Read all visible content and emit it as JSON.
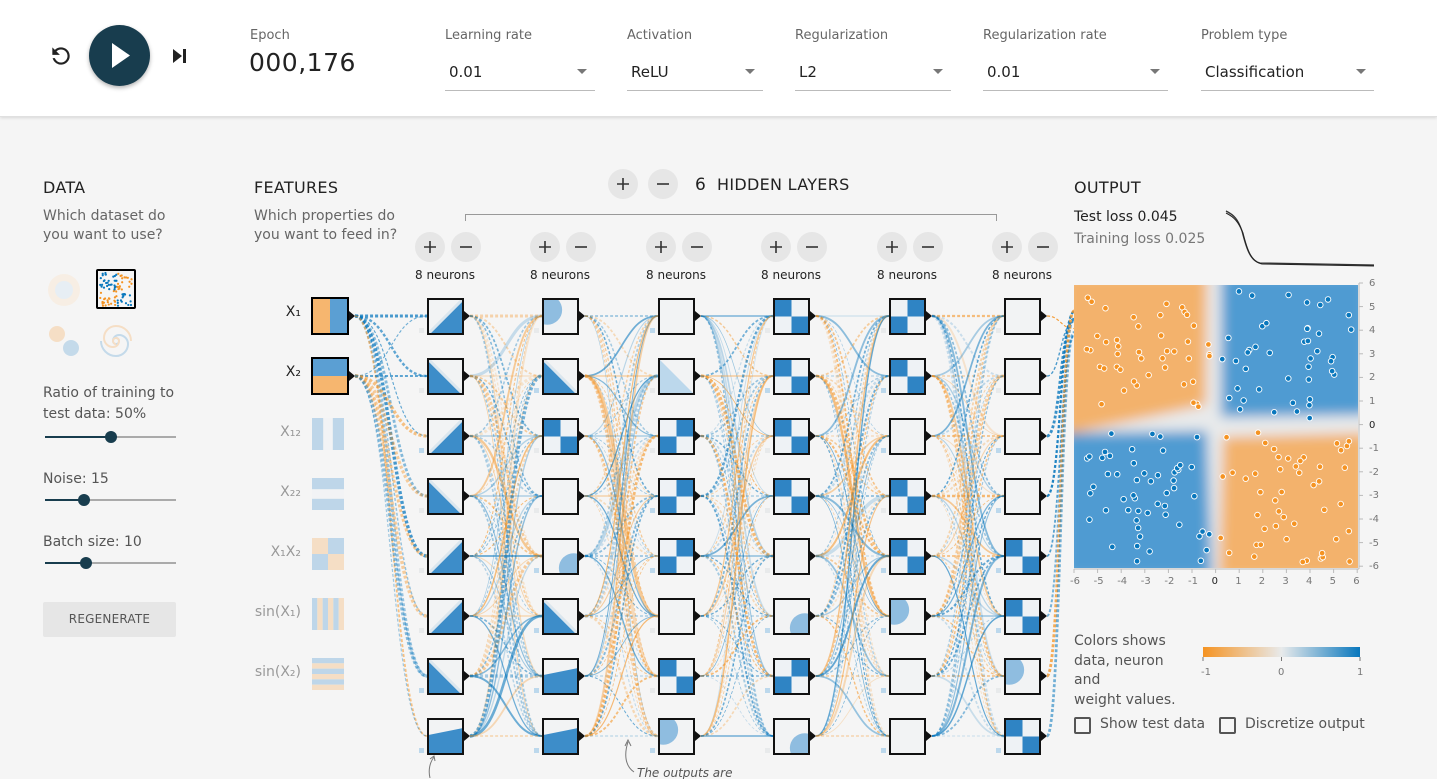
{
  "controls": {
    "reset_icon": "reset-icon",
    "play_icon": "play-icon",
    "step_icon": "step-forward-icon"
  },
  "epoch": {
    "label": "Epoch",
    "value": "000,176"
  },
  "params": [
    {
      "label": "Learning rate",
      "value": "0.01"
    },
    {
      "label": "Activation",
      "value": "ReLU"
    },
    {
      "label": "Regularization",
      "value": "L2"
    },
    {
      "label": "Regularization rate",
      "value": "0.01"
    },
    {
      "label": "Problem type",
      "value": "Classification"
    }
  ],
  "data": {
    "title": "DATA",
    "desc_line1": "Which dataset do",
    "desc_line2": "you want to use?",
    "datasets": [
      "circle",
      "xor",
      "gaussian",
      "spiral"
    ],
    "selected_dataset": "xor",
    "ratio_label": "Ratio of training to",
    "ratio_label2": "test data:  50%",
    "ratio_value": 50,
    "noise_label": "Noise:  15",
    "noise_value": 15,
    "batch_label": "Batch size:  10",
    "batch_value": 10,
    "regenerate": "REGENERATE"
  },
  "features": {
    "title": "FEATURES",
    "desc_line1": "Which properties do",
    "desc_line2": "you want to feed in?",
    "items": [
      {
        "label": "X₁",
        "active": true
      },
      {
        "label": "X₂",
        "active": true
      },
      {
        "label": "X₁₂",
        "active": false
      },
      {
        "label": "X₂₂",
        "active": false
      },
      {
        "label": "X₁X₂",
        "active": false
      },
      {
        "label": "sin(X₁)",
        "active": false
      },
      {
        "label": "sin(X₂)",
        "active": false
      }
    ]
  },
  "network": {
    "hidden_layers_count": "6",
    "hidden_layers_label": "HIDDEN LAYERS",
    "layers": [
      {
        "neurons_label": "8 neurons"
      },
      {
        "neurons_label": "8 neurons"
      },
      {
        "neurons_label": "8 neurons"
      },
      {
        "neurons_label": "8 neurons"
      },
      {
        "neurons_label": "8 neurons"
      },
      {
        "neurons_label": "8 neurons"
      }
    ],
    "annotation": "The outputs are"
  },
  "output": {
    "title": "OUTPUT",
    "test_loss": "Test loss 0.045",
    "training_loss": "Training loss 0.025",
    "y_ticks": [
      "6",
      "5",
      "4",
      "3",
      "2",
      "1",
      "0",
      "-1",
      "-2",
      "-3",
      "-4",
      "-5",
      "-6"
    ],
    "x_ticks": [
      "-6",
      "-5",
      "-4",
      "-3",
      "-2",
      "-1",
      "0",
      "1",
      "2",
      "3",
      "4",
      "5",
      "6"
    ],
    "legend_line1": "Colors shows",
    "legend_line2": "data, neuron and",
    "legend_line3": "weight values.",
    "legend_min": "-1",
    "legend_mid": "0",
    "legend_max": "1",
    "show_test_label": "Show test data",
    "discretize_label": "Discretize output",
    "show_test_checked": false,
    "discretize_checked": false
  },
  "colors": {
    "orange": "#f59322",
    "blue": "#0877bd",
    "dark": "#183d4e"
  }
}
